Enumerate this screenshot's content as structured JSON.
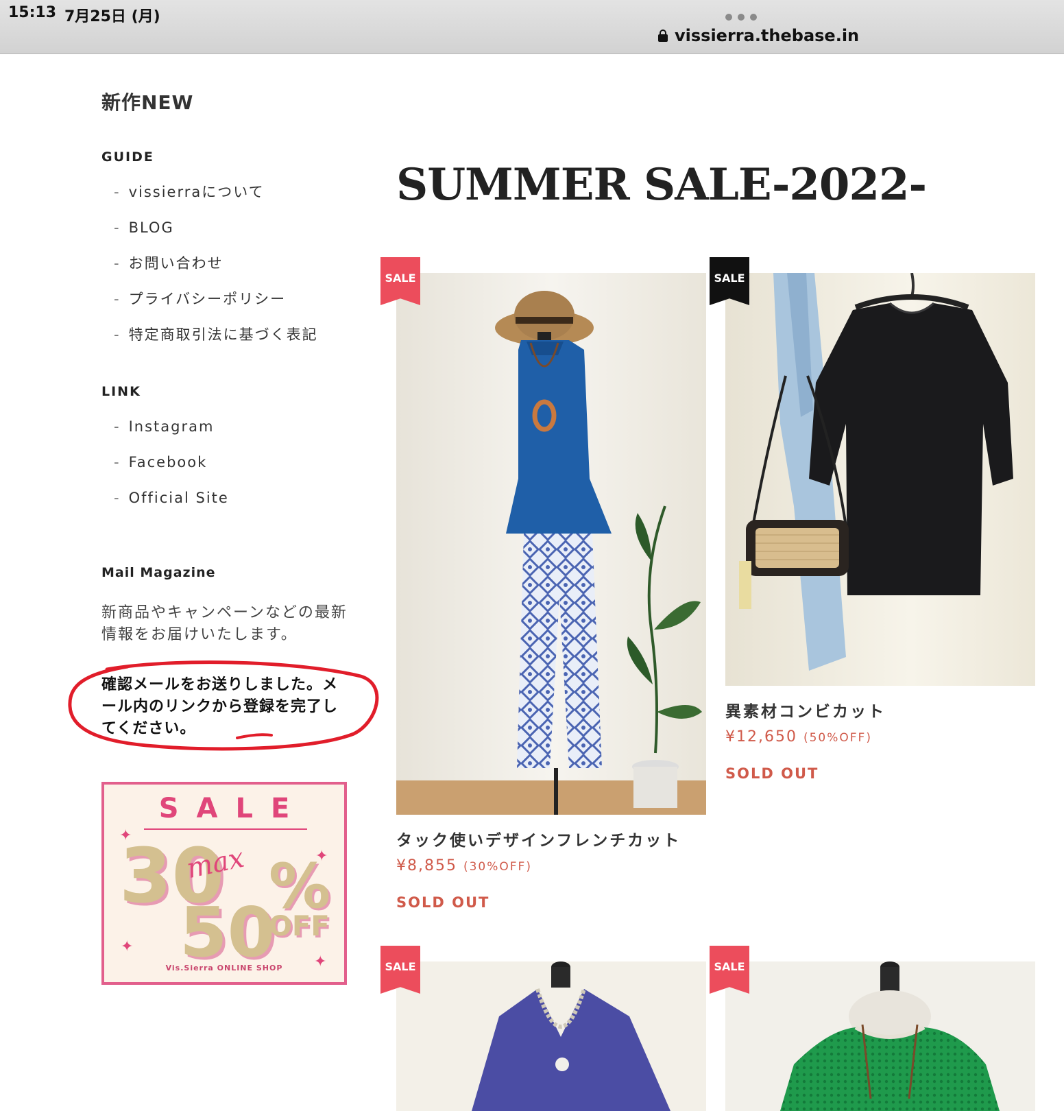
{
  "status_bar": {
    "time": "15:13",
    "date": "7月25日 (月)"
  },
  "browser": {
    "url": "vissierra.thebase.in"
  },
  "sidebar": {
    "shop_title": "新作NEW",
    "guide": {
      "title": "GUIDE",
      "items": [
        "vissierraについて",
        "BLOG",
        "お問い合わせ",
        "プライバシーポリシー",
        "特定商取引法に基づく表記"
      ]
    },
    "link": {
      "title": "LINK",
      "items": [
        "Instagram",
        "Facebook",
        "Official Site"
      ]
    },
    "mail_magazine": {
      "title": "Mail Magazine",
      "description": "新商品やキャンペーンなどの最新情報をお届けいたします。",
      "confirmation": "確認メールをお送りしました。メール内のリンクから登録を完了してください。"
    },
    "sale_banner": {
      "headline": "SALE",
      "max_label": "max",
      "discount_from": "30",
      "discount_to": "50",
      "percent": "%",
      "off": "OFF",
      "shop_name": "Vis.Sierra ONLINE SHOP"
    }
  },
  "main": {
    "title": "SUMMER SALE-2022-",
    "products": [
      {
        "badge": "SALE",
        "badge_color": "#ec4d5c",
        "name": "タック使いデザインフレンチカット",
        "price": "¥8,855",
        "discount": "(30%OFF)",
        "status": "SOLD OUT"
      },
      {
        "badge": "SALE",
        "badge_color": "#111111",
        "name": "異素材コンビカット",
        "price": "¥12,650",
        "discount": "(50%OFF)",
        "status": "SOLD OUT"
      },
      {
        "badge": "SALE",
        "badge_color": "#ec4d5c"
      },
      {
        "badge": "SALE",
        "badge_color": "#ec4d5c"
      }
    ]
  },
  "colors": {
    "accent": "#d05a4a",
    "ribbon_red": "#ec4d5c",
    "banner_pink": "#e0467a",
    "annotation_red": "#e11d2a"
  }
}
